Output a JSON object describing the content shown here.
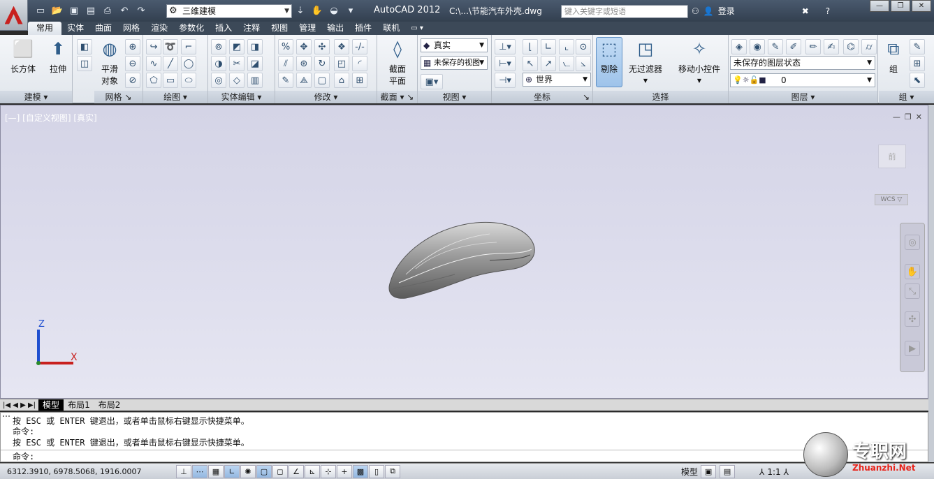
{
  "title": {
    "app": "AutoCAD 2012",
    "file": "C:\\...\\节能汽车外壳.dwg",
    "workspace": "三维建模",
    "search_placeholder": "键入关键字或短语",
    "login": "登录"
  },
  "tabs": [
    {
      "label": "常用",
      "active": true
    },
    {
      "label": "实体"
    },
    {
      "label": "曲面"
    },
    {
      "label": "网格"
    },
    {
      "label": "渲染"
    },
    {
      "label": "参数化"
    },
    {
      "label": "插入"
    },
    {
      "label": "注释"
    },
    {
      "label": "视图"
    },
    {
      "label": "管理"
    },
    {
      "label": "输出"
    },
    {
      "label": "插件"
    },
    {
      "label": "联机"
    }
  ],
  "ribbon": {
    "modeling": {
      "label": "建模",
      "box": "长方体",
      "extrude": "拉伸"
    },
    "mesh": {
      "label": "网格",
      "smooth_line1": "平滑",
      "smooth_line2": "对象"
    },
    "draw": {
      "label": "绘图"
    },
    "solid_edit": {
      "label": "实体编辑"
    },
    "modify": {
      "label": "修改"
    },
    "section": {
      "label": "截面",
      "plane_line1": "截面",
      "plane_line2": "平面"
    },
    "view": {
      "label": "视图",
      "visual_style": "真实",
      "saved_view": "未保存的视图"
    },
    "coordinates": {
      "label": "坐标",
      "ucs": "世界"
    },
    "selection": {
      "label": "选择",
      "culling": "剔除",
      "no_filter": "无过滤器",
      "gizmo": "移动小控件"
    },
    "layers": {
      "label": "图层",
      "layer_state": "未保存的图层状态",
      "current_layer": "0"
    },
    "groups": {
      "label": "组",
      "group": "组"
    }
  },
  "viewport": {
    "label": "[—] [自定义视图] [真实]",
    "viewcube_face": "前",
    "wcs": "WCS",
    "ucs_x": "X",
    "ucs_z": "Z"
  },
  "layout_tabs": [
    {
      "label": "模型",
      "active": true
    },
    {
      "label": "布局1"
    },
    {
      "label": "布局2"
    }
  ],
  "command": {
    "lines": [
      "按 ESC 或 ENTER 键退出，或者单击鼠标右键显示快捷菜单。",
      "命令:",
      "按 ESC 或 ENTER 键退出，或者单击鼠标右键显示快捷菜单。"
    ],
    "prompt": "命令:"
  },
  "status": {
    "coordinates": "6312.3910, 6978.5068, 1916.0007",
    "model": "模型",
    "scale": "1:1"
  },
  "watermark": {
    "cn": "专职网",
    "en": "Zhuanzhi.Net"
  }
}
